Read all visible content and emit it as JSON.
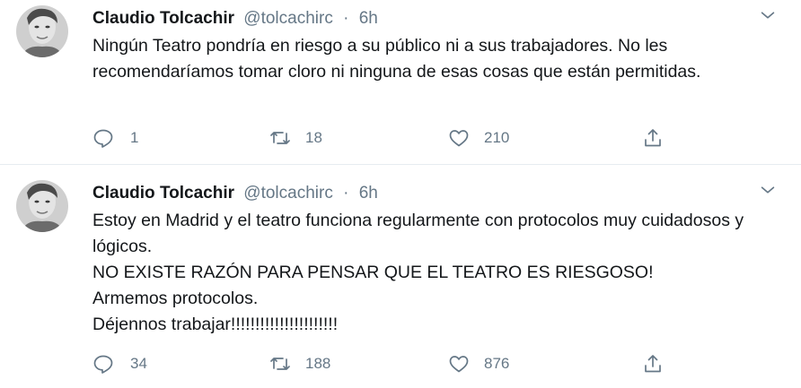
{
  "tweets": [
    {
      "author": {
        "display_name": "Claudio Tolcachir",
        "handle": "@tolcachirc",
        "avatar": "avatar-photo"
      },
      "separator": "·",
      "time": "6h",
      "text": "Ningún Teatro pondría en riesgo a su público ni a sus trabajadores. No les recomendaríamos tomar cloro ni ninguna de esas cosas que están permitidas.",
      "replies": "1",
      "retweets": "18",
      "likes": "210",
      "icons": [
        "chevron-down-icon",
        "reply-icon",
        "retweet-icon",
        "heart-icon",
        "share-icon"
      ]
    },
    {
      "author": {
        "display_name": "Claudio Tolcachir",
        "handle": "@tolcachirc",
        "avatar": "avatar-photo"
      },
      "separator": "·",
      "time": "6h",
      "text": "Estoy en Madrid y el teatro funciona regularmente con protocolos muy cuidadosos y lógicos.\nNO EXISTE RAZÓN PARA PENSAR QUE EL TEATRO ES RIESGOSO!\nArmemos protocolos.\nDéjennos trabajar!!!!!!!!!!!!!!!!!!!!!!",
      "replies": "34",
      "retweets": "188",
      "likes": "876",
      "icons": [
        "chevron-down-icon",
        "reply-icon",
        "retweet-icon",
        "heart-icon",
        "share-icon"
      ]
    }
  ],
  "colors": {
    "text": "#14171a",
    "secondary": "#657786",
    "divider": "#e6ecf0"
  }
}
